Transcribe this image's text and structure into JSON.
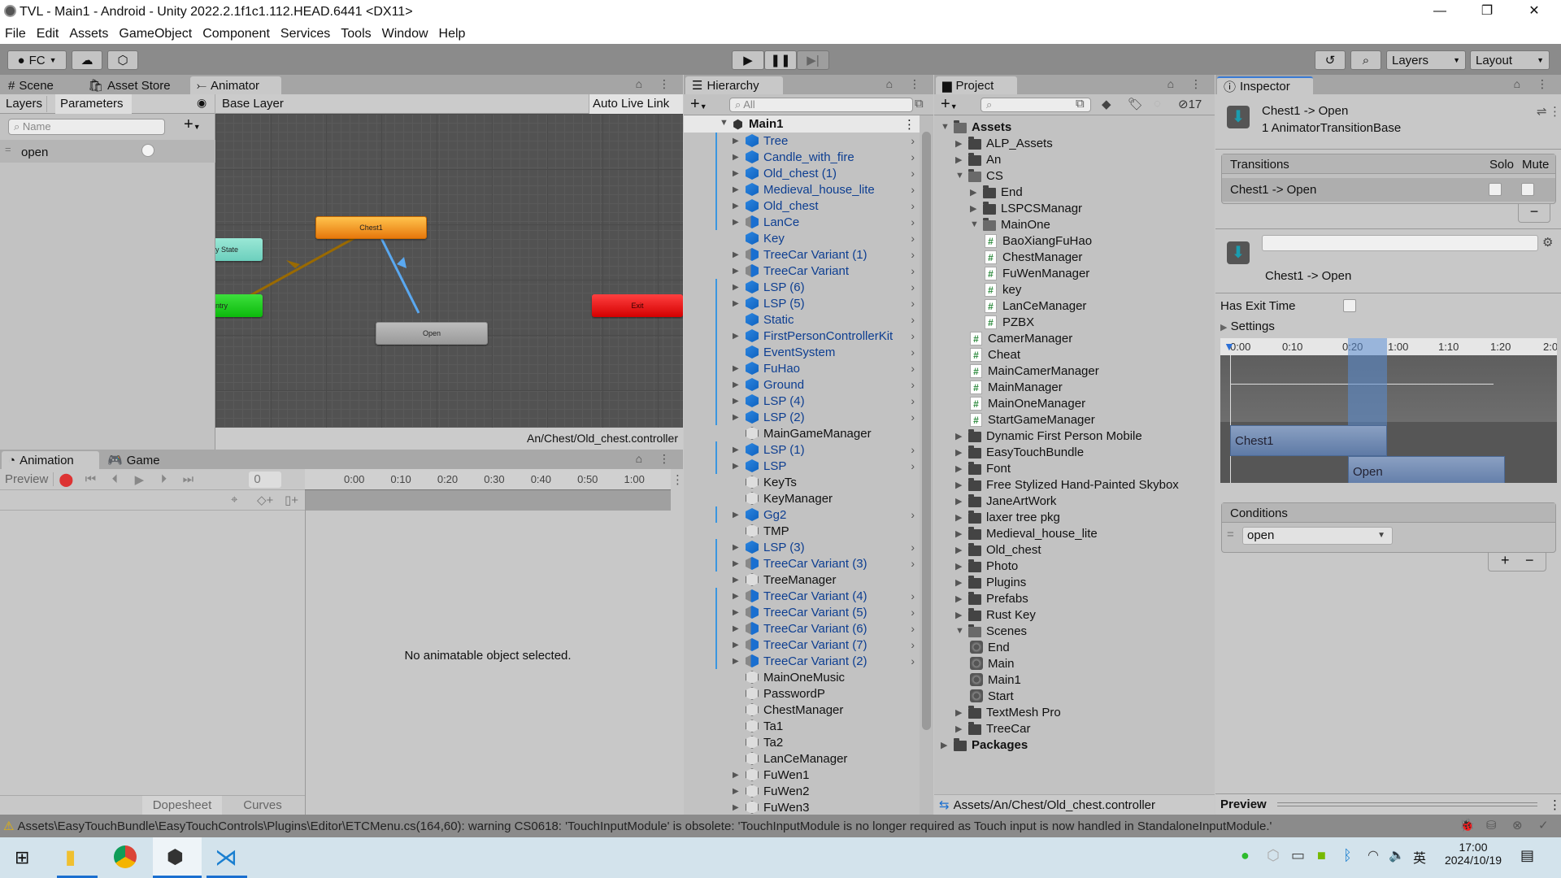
{
  "window": {
    "title": "TVL - Main1 - Android - Unity 2022.2.1f1c1.112.HEAD.6441 <DX11>",
    "controls": {
      "minimize": "—",
      "maximize": "❐",
      "close": "✕"
    }
  },
  "menu": [
    "File",
    "Edit",
    "Assets",
    "GameObject",
    "Component",
    "Services",
    "Tools",
    "Window",
    "Help"
  ],
  "toolbar": {
    "account": "FC",
    "layers": "Layers",
    "layout": "Layout"
  },
  "animator": {
    "tabs": [
      "Scene",
      "Asset Store",
      "Animator"
    ],
    "sub_tabs": [
      "Layers",
      "Parameters"
    ],
    "breadcrumb": "Base Layer",
    "auto_live_link": "Auto Live Link",
    "search_placeholder": "Name",
    "parameters": [
      {
        "name": "open",
        "type": "bool",
        "value": false
      }
    ],
    "states": {
      "chest1": "Chest1",
      "any_state": "y State",
      "entry": "ntry",
      "exit": "Exit",
      "open": "Open"
    },
    "controller_path": "An/Chest/Old_chest.controller"
  },
  "animation": {
    "tabs": [
      "Animation",
      "Game"
    ],
    "preview": "Preview",
    "frame": "0",
    "ticks": [
      "0:00",
      "0:10",
      "0:20",
      "0:30",
      "0:40",
      "0:50",
      "1:00"
    ],
    "empty_message": "No animatable object selected.",
    "bottom_tabs": [
      "Dopesheet",
      "Curves"
    ]
  },
  "hierarchy": {
    "title": "Hierarchy",
    "search_placeholder": "All",
    "scene": "Main1",
    "items": [
      {
        "name": "Tree",
        "kind": "blue",
        "expand": true,
        "bar": true
      },
      {
        "name": "Candle_with_fire",
        "kind": "blue",
        "expand": true,
        "bar": true
      },
      {
        "name": "Old_chest (1)",
        "kind": "blue",
        "expand": true,
        "bar": true
      },
      {
        "name": "Medieval_house_lite",
        "kind": "blue",
        "expand": true,
        "bar": true
      },
      {
        "name": "Old_chest",
        "kind": "blue",
        "expand": true,
        "bar": true
      },
      {
        "name": "LanCe",
        "kind": "variant",
        "expand": true,
        "bar": true
      },
      {
        "name": "Key",
        "kind": "blue",
        "expand": false,
        "bar": false
      },
      {
        "name": "TreeCar Variant (1)",
        "kind": "variant",
        "expand": true,
        "bar": false
      },
      {
        "name": "TreeCar Variant",
        "kind": "variant",
        "expand": true,
        "bar": false
      },
      {
        "name": "LSP (6)",
        "kind": "blue",
        "expand": true,
        "bar": true
      },
      {
        "name": "LSP (5)",
        "kind": "blue",
        "expand": true,
        "bar": true
      },
      {
        "name": "Static",
        "kind": "blue",
        "expand": false,
        "bar": true
      },
      {
        "name": "FirstPersonControllerKit",
        "kind": "blue",
        "expand": true,
        "bar": true
      },
      {
        "name": "EventSystem",
        "kind": "blue",
        "expand": false,
        "bar": true
      },
      {
        "name": "FuHao",
        "kind": "blue",
        "expand": true,
        "bar": true
      },
      {
        "name": "Ground",
        "kind": "blue",
        "expand": true,
        "bar": true
      },
      {
        "name": "LSP (4)",
        "kind": "blue",
        "expand": true,
        "bar": true
      },
      {
        "name": "LSP (2)",
        "kind": "blue",
        "expand": true,
        "bar": true
      },
      {
        "name": "MainGameManager",
        "kind": "empty",
        "expand": false,
        "bar": false
      },
      {
        "name": "LSP (1)",
        "kind": "blue",
        "expand": true,
        "bar": true
      },
      {
        "name": "LSP",
        "kind": "blue",
        "expand": true,
        "bar": true
      },
      {
        "name": "KeyTs",
        "kind": "empty",
        "expand": false,
        "bar": false
      },
      {
        "name": "KeyManager",
        "kind": "empty",
        "expand": false,
        "bar": false
      },
      {
        "name": "Gg2",
        "kind": "blue",
        "expand": true,
        "bar": true
      },
      {
        "name": "TMP",
        "kind": "empty",
        "expand": false,
        "bar": false
      },
      {
        "name": "LSP (3)",
        "kind": "blue",
        "expand": true,
        "bar": true
      },
      {
        "name": "TreeCar Variant (3)",
        "kind": "variant",
        "expand": true,
        "bar": true
      },
      {
        "name": "TreeManager",
        "kind": "empty",
        "expand": true,
        "bar": false
      },
      {
        "name": "TreeCar Variant (4)",
        "kind": "variant",
        "expand": true,
        "bar": true
      },
      {
        "name": "TreeCar Variant (5)",
        "kind": "variant",
        "expand": true,
        "bar": true
      },
      {
        "name": "TreeCar Variant (6)",
        "kind": "variant",
        "expand": true,
        "bar": true
      },
      {
        "name": "TreeCar Variant (7)",
        "kind": "variant",
        "expand": true,
        "bar": true
      },
      {
        "name": "TreeCar Variant (2)",
        "kind": "variant",
        "expand": true,
        "bar": true
      },
      {
        "name": "MainOneMusic",
        "kind": "empty",
        "expand": false,
        "bar": false
      },
      {
        "name": "PasswordP",
        "kind": "empty",
        "expand": false,
        "bar": false
      },
      {
        "name": "ChestManager",
        "kind": "empty",
        "expand": false,
        "bar": false
      },
      {
        "name": "Ta1",
        "kind": "empty",
        "expand": false,
        "bar": false
      },
      {
        "name": "Ta2",
        "kind": "empty",
        "expand": false,
        "bar": false
      },
      {
        "name": "LanCeManager",
        "kind": "empty",
        "expand": false,
        "bar": false
      },
      {
        "name": "FuWen1",
        "kind": "empty",
        "expand": true,
        "bar": false
      },
      {
        "name": "FuWen2",
        "kind": "empty",
        "expand": true,
        "bar": false
      },
      {
        "name": "FuWen3",
        "kind": "empty",
        "expand": true,
        "bar": false
      }
    ]
  },
  "project": {
    "title": "Project",
    "hidden_count": "17",
    "tree": [
      {
        "name": "Assets",
        "depth": 0,
        "type": "folder-open",
        "tri": "down",
        "bold": true
      },
      {
        "name": "ALP_Assets",
        "depth": 1,
        "type": "folder",
        "tri": "right"
      },
      {
        "name": "An",
        "depth": 1,
        "type": "folder",
        "tri": "right"
      },
      {
        "name": "CS",
        "depth": 1,
        "type": "folder-open",
        "tri": "down"
      },
      {
        "name": "End",
        "depth": 2,
        "type": "folder",
        "tri": "right"
      },
      {
        "name": "LSPCSManagr",
        "depth": 2,
        "type": "folder",
        "tri": "right"
      },
      {
        "name": "MainOne",
        "depth": 2,
        "type": "folder-open",
        "tri": "down"
      },
      {
        "name": "BaoXiangFuHao",
        "depth": 3,
        "type": "script"
      },
      {
        "name": "ChestManager",
        "depth": 3,
        "type": "script"
      },
      {
        "name": "FuWenManager",
        "depth": 3,
        "type": "script"
      },
      {
        "name": "key",
        "depth": 3,
        "type": "script"
      },
      {
        "name": "LanCeManager",
        "depth": 3,
        "type": "script"
      },
      {
        "name": "PZBX",
        "depth": 3,
        "type": "script"
      },
      {
        "name": "CamerManager",
        "depth": 2,
        "type": "script"
      },
      {
        "name": "Cheat",
        "depth": 2,
        "type": "script"
      },
      {
        "name": "MainCamerManager",
        "depth": 2,
        "type": "script"
      },
      {
        "name": "MainManager",
        "depth": 2,
        "type": "script"
      },
      {
        "name": "MainOneManager",
        "depth": 2,
        "type": "script"
      },
      {
        "name": "StartGameManager",
        "depth": 2,
        "type": "script"
      },
      {
        "name": "Dynamic First Person Mobile",
        "depth": 1,
        "type": "folder",
        "tri": "right"
      },
      {
        "name": "EasyTouchBundle",
        "depth": 1,
        "type": "folder",
        "tri": "right"
      },
      {
        "name": "Font",
        "depth": 1,
        "type": "folder",
        "tri": "right"
      },
      {
        "name": "Free Stylized Hand-Painted Skybox",
        "depth": 1,
        "type": "folder",
        "tri": "right"
      },
      {
        "name": "JaneArtWork",
        "depth": 1,
        "type": "folder",
        "tri": "right"
      },
      {
        "name": "laxer tree pkg",
        "depth": 1,
        "type": "folder",
        "tri": "right"
      },
      {
        "name": "Medieval_house_lite",
        "depth": 1,
        "type": "folder",
        "tri": "right"
      },
      {
        "name": "Old_chest",
        "depth": 1,
        "type": "folder",
        "tri": "right"
      },
      {
        "name": "Photo",
        "depth": 1,
        "type": "folder",
        "tri": "right"
      },
      {
        "name": "Plugins",
        "depth": 1,
        "type": "folder",
        "tri": "right"
      },
      {
        "name": "Prefabs",
        "depth": 1,
        "type": "folder",
        "tri": "right"
      },
      {
        "name": "Rust Key",
        "depth": 1,
        "type": "folder",
        "tri": "right"
      },
      {
        "name": "Scenes",
        "depth": 1,
        "type": "folder-open",
        "tri": "down"
      },
      {
        "name": "End",
        "depth": 2,
        "type": "scene"
      },
      {
        "name": "Main",
        "depth": 2,
        "type": "scene"
      },
      {
        "name": "Main1",
        "depth": 2,
        "type": "scene"
      },
      {
        "name": "Start",
        "depth": 2,
        "type": "scene"
      },
      {
        "name": "TextMesh Pro",
        "depth": 1,
        "type": "folder",
        "tri": "right"
      },
      {
        "name": "TreeCar",
        "depth": 1,
        "type": "folder",
        "tri": "right"
      },
      {
        "name": "Packages",
        "depth": 0,
        "type": "folder",
        "tri": "right",
        "bold": true
      }
    ],
    "footer_path": "Assets/An/Chest/Old_chest.controller"
  },
  "inspector": {
    "title": "Inspector",
    "header_title": "Chest1 -> Open",
    "header_subtitle": "1 AnimatorTransitionBase",
    "transitions_label": "Transitions",
    "solo_label": "Solo",
    "mute_label": "Mute",
    "transition_row": "Chest1 -> Open",
    "name_field": "",
    "transition_name": "Chest1 -> Open",
    "has_exit_time_label": "Has Exit Time",
    "has_exit_time": false,
    "settings_label": "Settings",
    "timeline_ticks": [
      "0:00",
      "0:10",
      "0:20",
      "1:00",
      "1:10",
      "1:20",
      "2:0"
    ],
    "timeline_clips": [
      "Chest1",
      "Open"
    ],
    "conditions_label": "Conditions",
    "condition_value": "open",
    "preview_label": "Preview"
  },
  "status": {
    "message": "Assets\\EasyTouchBundle\\EasyTouchControls\\Plugins\\Editor\\ETCMenu.cs(164,60): warning CS0618: 'TouchInputModule' is obsolete: 'TouchInputModule is no longer required as Touch input is now handled in StandaloneInputModule.'"
  },
  "taskbar": {
    "time": "17:00",
    "date": "2024/10/19",
    "ime": "英"
  }
}
